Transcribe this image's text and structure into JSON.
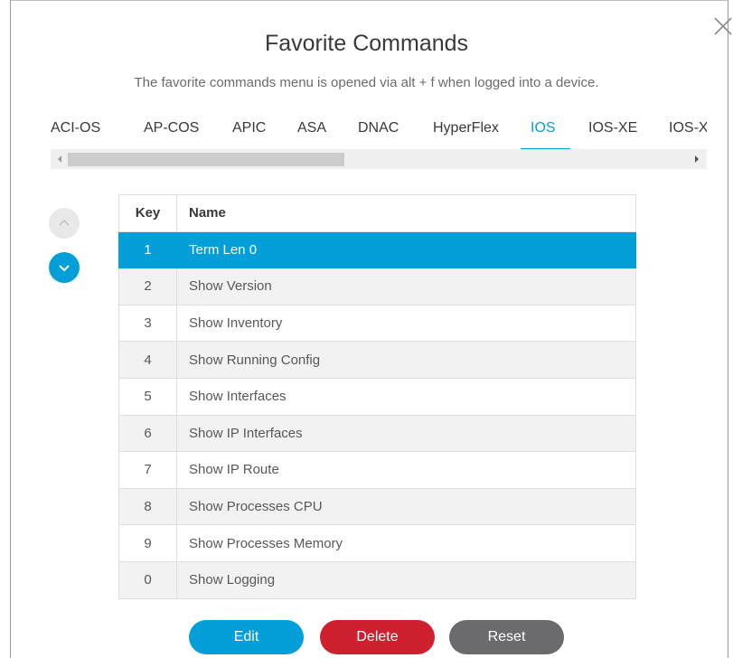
{
  "dialog": {
    "title": "Favorite Commands",
    "subtitle": "The favorite commands menu is opened via alt + f when logged into a device."
  },
  "tabs": [
    {
      "label": "ACI-OS",
      "active": false
    },
    {
      "label": "AP-COS",
      "active": false
    },
    {
      "label": "APIC",
      "active": false
    },
    {
      "label": "ASA",
      "active": false
    },
    {
      "label": "DNAC",
      "active": false
    },
    {
      "label": "HyperFlex",
      "active": false
    },
    {
      "label": "IOS",
      "active": true
    },
    {
      "label": "IOS-XE",
      "active": false
    },
    {
      "label": "IOS-XR",
      "active": false
    }
  ],
  "table": {
    "headers": {
      "key": "Key",
      "name": "Name"
    },
    "rows": [
      {
        "key": "1",
        "name": "Term Len 0",
        "selected": true
      },
      {
        "key": "2",
        "name": "Show Version",
        "selected": false
      },
      {
        "key": "3",
        "name": "Show Inventory",
        "selected": false
      },
      {
        "key": "4",
        "name": "Show Running Config",
        "selected": false
      },
      {
        "key": "5",
        "name": "Show Interfaces",
        "selected": false
      },
      {
        "key": "6",
        "name": "Show IP Interfaces",
        "selected": false
      },
      {
        "key": "7",
        "name": "Show IP Route",
        "selected": false
      },
      {
        "key": "8",
        "name": "Show Processes CPU",
        "selected": false
      },
      {
        "key": "9",
        "name": "Show Processes Memory",
        "selected": false
      },
      {
        "key": "0",
        "name": "Show Logging",
        "selected": false
      }
    ]
  },
  "buttons": {
    "edit": "Edit",
    "delete": "Delete",
    "reset": "Reset"
  },
  "icons": {
    "close": "close-icon",
    "move_up": "chevron-up-icon",
    "move_down": "chevron-down-icon",
    "scroll_left": "caret-left-icon",
    "scroll_right": "caret-right-icon"
  },
  "colors": {
    "accent": "#049fd9",
    "danger": "#cf2030",
    "neutral": "#6b6b6e",
    "text": "#39393b"
  }
}
